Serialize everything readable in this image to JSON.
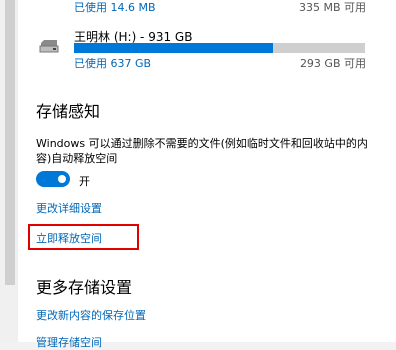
{
  "top_drive": {
    "used": "已使用 14.6 MB",
    "free": "335 MB 可用"
  },
  "drive_h": {
    "title": "王明林 (H:) - 931 GB",
    "used": "已使用 637 GB",
    "free": "293 GB 可用",
    "used_fraction": 0.684
  },
  "storage_sense": {
    "heading": "存储感知",
    "description": "Windows 可以通过删除不需要的文件(例如临时文件和回收站中的内容)自动释放空间",
    "toggle_state": "开",
    "change_settings_link": "更改详细设置",
    "free_up_now_link": "立即释放空间"
  },
  "more_settings": {
    "heading": "更多存储设置",
    "change_save_location_link": "更改新内容的保存位置",
    "manage_spaces_link": "管理存储空间"
  },
  "colors": {
    "accent": "#0078d7",
    "link": "#0067b8",
    "highlight": "#e00000"
  }
}
